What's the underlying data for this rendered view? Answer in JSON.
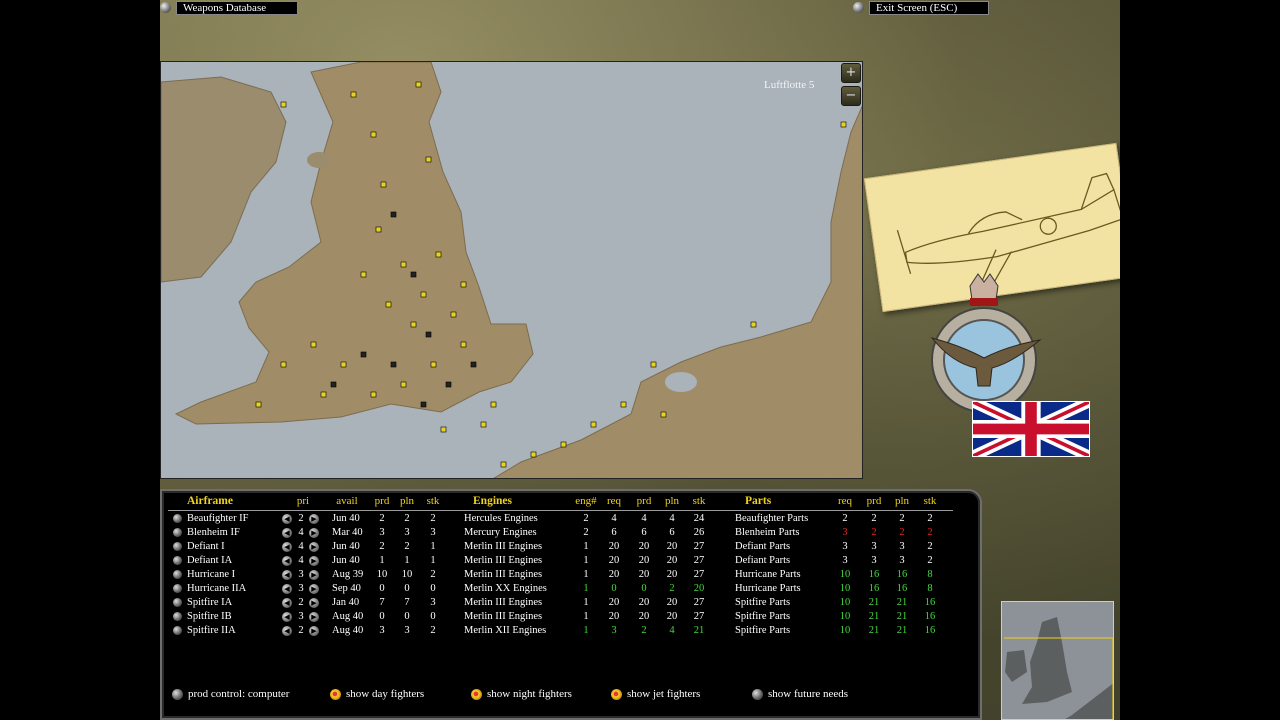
{
  "topbar": {
    "weapons_label": "Weapons Database",
    "exit_label": "Exit Screen (ESC)"
  },
  "map": {
    "region_label": "Luftflotte 5",
    "zoom_in": "+",
    "zoom_out": "−"
  },
  "table": {
    "airframe_headers": [
      "Airframe",
      "pri",
      "avail",
      "prd",
      "pln",
      "stk"
    ],
    "engine_headers": [
      "Engines",
      "eng#",
      "req",
      "prd",
      "pln",
      "stk"
    ],
    "parts_headers": [
      "Parts",
      "req",
      "prd",
      "pln",
      "stk"
    ],
    "rows": [
      {
        "airframe": "Beaufighter IF",
        "pri": "2",
        "avail": "Jun 40",
        "prd": "2",
        "pln": "2",
        "stk": "2",
        "engine": "Hercules Engines",
        "eng": "2",
        "ereq": "4",
        "eprd": "4",
        "epln": "4",
        "estk": "24",
        "part": "Beaufighter Parts",
        "preq": "2",
        "pprd": "2",
        "ppln": "2",
        "pstk": "2",
        "ecolor": "white",
        "pcolor": "white"
      },
      {
        "airframe": "Blenheim IF",
        "pri": "4",
        "avail": "Mar 40",
        "prd": "3",
        "pln": "3",
        "stk": "3",
        "engine": "Mercury Engines",
        "eng": "2",
        "ereq": "6",
        "eprd": "6",
        "epln": "6",
        "estk": "26",
        "part": "Blenheim Parts",
        "preq": "3",
        "pprd": "2",
        "ppln": "2",
        "pstk": "2",
        "ecolor": "white",
        "pcolor": "red"
      },
      {
        "airframe": "Defiant I",
        "pri": "4",
        "avail": "Jun 40",
        "prd": "2",
        "pln": "2",
        "stk": "1",
        "engine": "Merlin III Engines",
        "eng": "1",
        "ereq": "20",
        "eprd": "20",
        "epln": "20",
        "estk": "27",
        "part": "Defiant Parts",
        "preq": "3",
        "pprd": "3",
        "ppln": "3",
        "pstk": "2",
        "ecolor": "white",
        "pcolor": "white"
      },
      {
        "airframe": "Defiant IA",
        "pri": "4",
        "avail": "Jun 40",
        "prd": "1",
        "pln": "1",
        "stk": "1",
        "engine": "Merlin III Engines",
        "eng": "1",
        "ereq": "20",
        "eprd": "20",
        "epln": "20",
        "estk": "27",
        "part": "Defiant Parts",
        "preq": "3",
        "pprd": "3",
        "ppln": "3",
        "pstk": "2",
        "ecolor": "white",
        "pcolor": "white"
      },
      {
        "airframe": "Hurricane I",
        "pri": "3",
        "avail": "Aug 39",
        "prd": "10",
        "pln": "10",
        "stk": "2",
        "engine": "Merlin III Engines",
        "eng": "1",
        "ereq": "20",
        "eprd": "20",
        "epln": "20",
        "estk": "27",
        "part": "Hurricane Parts",
        "preq": "10",
        "pprd": "16",
        "ppln": "16",
        "pstk": "8",
        "ecolor": "white",
        "pcolor": "green"
      },
      {
        "airframe": "Hurricane IIA",
        "pri": "3",
        "avail": "Sep 40",
        "prd": "0",
        "pln": "0",
        "stk": "0",
        "engine": "Merlin XX Engines",
        "eng": "1",
        "ereq": "0",
        "eprd": "0",
        "epln": "2",
        "estk": "20",
        "part": "Hurricane Parts",
        "preq": "10",
        "pprd": "16",
        "ppln": "16",
        "pstk": "8",
        "ecolor": "green",
        "pcolor": "green"
      },
      {
        "airframe": "Spitfire IA",
        "pri": "2",
        "avail": "Jan 40",
        "prd": "7",
        "pln": "7",
        "stk": "3",
        "engine": "Merlin III Engines",
        "eng": "1",
        "ereq": "20",
        "eprd": "20",
        "epln": "20",
        "estk": "27",
        "part": "Spitfire Parts",
        "preq": "10",
        "pprd": "21",
        "ppln": "21",
        "pstk": "16",
        "ecolor": "white",
        "pcolor": "green"
      },
      {
        "airframe": "Spitfire IB",
        "pri": "3",
        "avail": "Aug 40",
        "prd": "0",
        "pln": "0",
        "stk": "0",
        "engine": "Merlin III Engines",
        "eng": "1",
        "ereq": "20",
        "eprd": "20",
        "epln": "20",
        "estk": "27",
        "part": "Spitfire Parts",
        "preq": "10",
        "pprd": "21",
        "ppln": "21",
        "pstk": "16",
        "ecolor": "white",
        "pcolor": "green"
      },
      {
        "airframe": "Spitfire IIA",
        "pri": "2",
        "avail": "Aug 40",
        "prd": "3",
        "pln": "3",
        "stk": "2",
        "engine": "Merlin XII Engines",
        "eng": "1",
        "ereq": "3",
        "eprd": "2",
        "epln": "4",
        "estk": "21",
        "part": "Spitfire Parts",
        "preq": "10",
        "pprd": "21",
        "ppln": "21",
        "pstk": "16",
        "ecolor": "green",
        "pcolor": "green"
      }
    ]
  },
  "footer": {
    "prod_control": "prod control: computer",
    "day_fighters": "show day fighters",
    "night_fighters": "show night fighters",
    "jet_fighters": "show jet fighters",
    "future_needs": "show future needs"
  },
  "colors": {
    "header": "#f0d21a",
    "good": "#46d83e",
    "bad": "#e0281f"
  }
}
